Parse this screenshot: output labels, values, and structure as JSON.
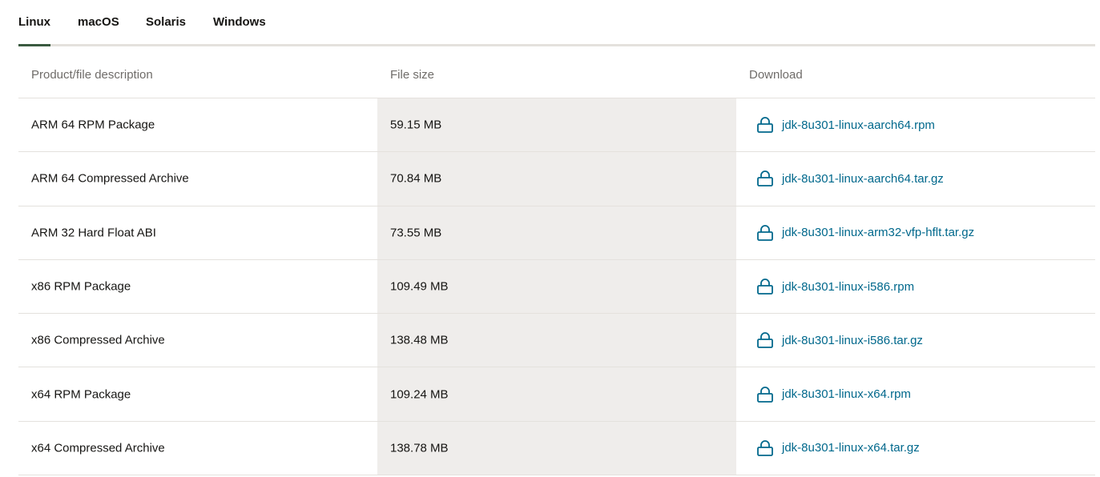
{
  "tabs": [
    {
      "label": "Linux",
      "active": true
    },
    {
      "label": "macOS",
      "active": false
    },
    {
      "label": "Solaris",
      "active": false
    },
    {
      "label": "Windows",
      "active": false
    }
  ],
  "table": {
    "headers": {
      "description": "Product/file description",
      "size": "File size",
      "download": "Download"
    },
    "rows": [
      {
        "description": "ARM 64 RPM Package",
        "size": "59.15 MB",
        "file": "jdk-8u301-linux-aarch64.rpm"
      },
      {
        "description": "ARM 64 Compressed Archive",
        "size": "70.84 MB",
        "file": "jdk-8u301-linux-aarch64.tar.gz"
      },
      {
        "description": "ARM 32 Hard Float ABI",
        "size": "73.55 MB",
        "file": "jdk-8u301-linux-arm32-vfp-hflt.tar.gz"
      },
      {
        "description": "x86 RPM Package",
        "size": "109.49 MB",
        "file": "jdk-8u301-linux-i586.rpm"
      },
      {
        "description": "x86 Compressed Archive",
        "size": "138.48 MB",
        "file": "jdk-8u301-linux-i586.tar.gz"
      },
      {
        "description": "x64 RPM Package",
        "size": "109.24 MB",
        "file": "jdk-8u301-linux-x64.rpm"
      },
      {
        "description": "x64 Compressed Archive",
        "size": "138.78 MB",
        "file": "jdk-8u301-linux-x64.tar.gz"
      }
    ]
  },
  "icons": {
    "download": "lock-icon"
  },
  "colors": {
    "link": "#00688c",
    "active_tab_underline": "#3a5a40",
    "shaded_column": "#efedeb",
    "divider": "#e4e1dd",
    "header_text": "#6f6c69"
  }
}
